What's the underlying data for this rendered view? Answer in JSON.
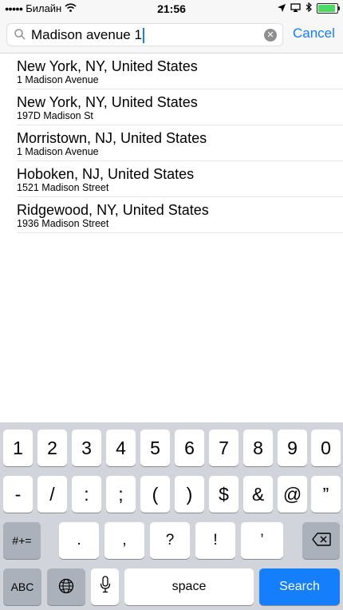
{
  "status": {
    "carrier": "Билайн",
    "time": "21:56"
  },
  "search": {
    "query": "Madison avenue 1",
    "cancel_label": "Cancel"
  },
  "results": [
    {
      "title": "New York, NY, United States",
      "subtitle": "1 Madison Avenue"
    },
    {
      "title": "New York, NY, United States",
      "subtitle": "197D Madison St"
    },
    {
      "title": "Morristown, NJ, United States",
      "subtitle": "1 Madison Avenue"
    },
    {
      "title": "Hoboken, NJ, United States",
      "subtitle": "1521 Madison Street"
    },
    {
      "title": "Ridgewood, NY, United States",
      "subtitle": "1936 Madison Street"
    }
  ],
  "keyboard": {
    "row1": [
      "1",
      "2",
      "3",
      "4",
      "5",
      "6",
      "7",
      "8",
      "9",
      "0"
    ],
    "row2": [
      "-",
      "/",
      ":",
      ";",
      "(",
      ")",
      "$",
      "&",
      "@",
      "”"
    ],
    "row3": [
      ".",
      ",",
      "?",
      "!",
      "’"
    ],
    "more_symbols": "#+=",
    "abc": "ABC",
    "space": "space",
    "search": "Search"
  },
  "colors": {
    "accent": "#147efb",
    "battery": "#4cd964"
  }
}
